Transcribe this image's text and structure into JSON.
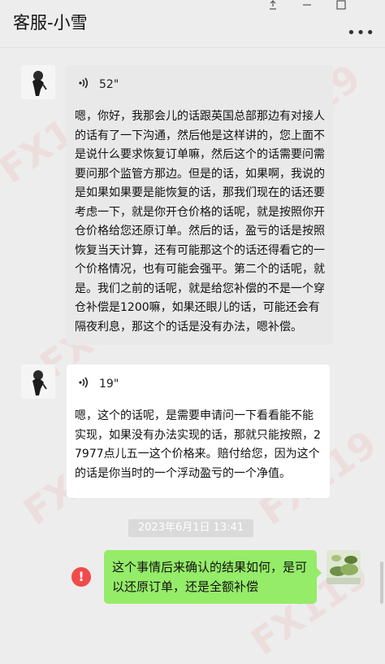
{
  "window": {
    "title": "客服-小雪",
    "controls": [
      "pin",
      "minimize",
      "maximize"
    ],
    "more_icon": "more-horizontal-icon"
  },
  "messages": [
    {
      "type": "voice",
      "direction": "incoming",
      "duration": "52\"",
      "transcript": "嗯，你好，我那会儿的话跟英国总部那边有对接人的话有了一下沟通，然后他是这样讲的，您上面不是说什么要求恢复订单嘛，然后这个的话需要问需要问那个监管方那边。但是的话，如果啊，我说的是如果如果要是能恢复的话，那我们现在的话还要考虑一下，就是你开仓价格的话呢，就是按照你开仓价格给您还原订单。然后的话，盈亏的话是按照恢复当天计算，还有可能那这个的话还得看它的一个价格情况，也有可能会强平。第二个的话呢，就是。我们之前的话呢，就是给您补偿的不是一个穿仓补偿是1200嘛，如果还眼儿的话，可能还会有隔夜利息，那这个的话是没有办法，嗯补偿。"
    },
    {
      "type": "voice",
      "direction": "incoming",
      "duration": "19\"",
      "transcript": "嗯，这个的话呢，是需要申请问一下看看能不能实现，如果没有办法实现的话，那就只能按照，27977点儿五一这个价格来。赔付给您，因为这个的话是你当时的一个浮动盈亏的一个净值。"
    },
    {
      "type": "timestamp",
      "text": "2023年6月1日 13:41"
    },
    {
      "type": "text",
      "direction": "outgoing",
      "text": "这个事情后来确认的结果如何，是可以还原订单，还是全额补偿",
      "status": "failed",
      "status_icon": "error-icon"
    }
  ],
  "watermark": "FX119",
  "colors": {
    "background": "#ededed",
    "incoming_bubble": "#ffffff",
    "outgoing_bubble": "#95ec69",
    "error": "#f24a4a"
  }
}
